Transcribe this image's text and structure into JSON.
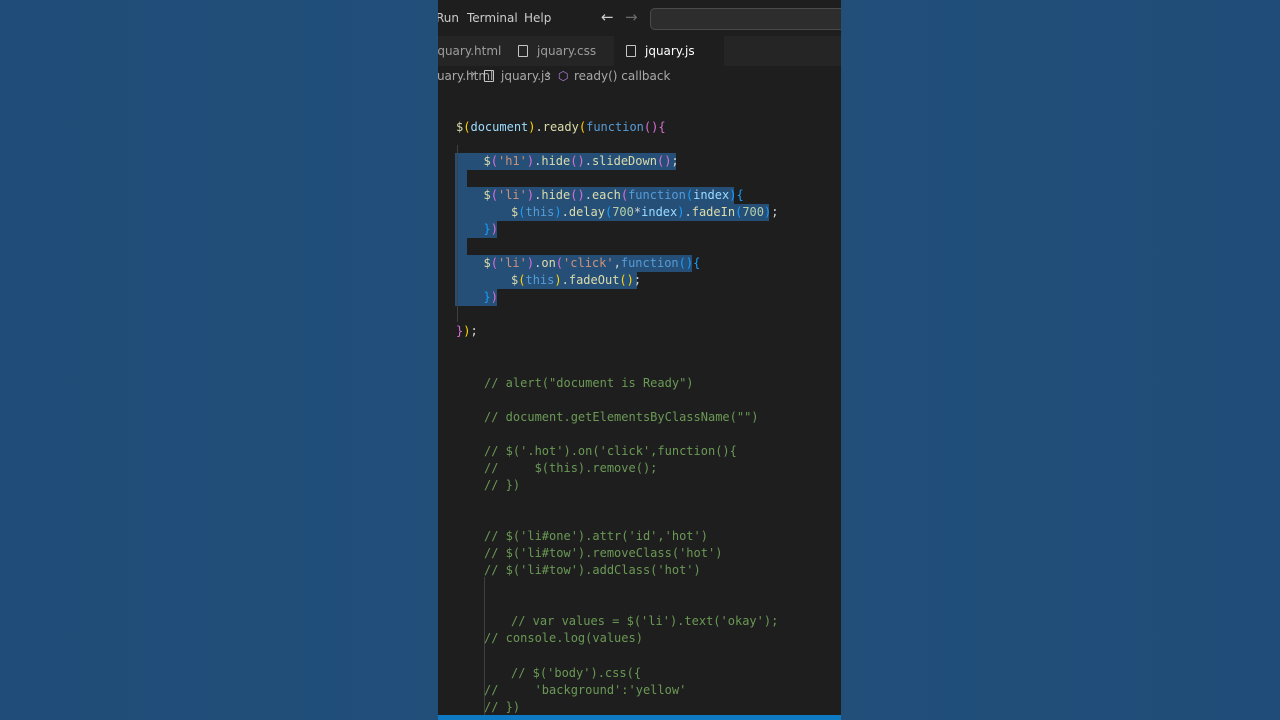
{
  "menu": {
    "items": [
      "Run",
      "Terminal",
      "Help"
    ]
  },
  "tabs": [
    {
      "label": "jquary.html",
      "active": false
    },
    {
      "label": "jquary.css",
      "active": false
    },
    {
      "label": "jquary.js",
      "active": true
    }
  ],
  "breadcrumb": {
    "file_html": "jquary.html",
    "file_js": "jquary.js",
    "symbol": "ready() callback"
  },
  "colors": {
    "accent": "#0e7ac4",
    "selection": "#264f78",
    "editor_bg": "#1e1e1e",
    "page_bg": "#22507a"
  },
  "code": {
    "line1": [
      [
        "$",
        "fn"
      ],
      [
        "(",
        "yel"
      ],
      [
        "document",
        "var"
      ],
      [
        ")",
        "yel"
      ],
      [
        ".",
        "plain"
      ],
      [
        "ready",
        "fn"
      ],
      [
        "(",
        "yel"
      ],
      [
        "function",
        "kw"
      ],
      [
        "(",
        "pur"
      ],
      [
        ")",
        "pur"
      ],
      [
        "{",
        "pur"
      ]
    ],
    "line2": [
      [
        "$",
        "fn"
      ],
      [
        "(",
        "pur"
      ],
      [
        "'h1'",
        "str"
      ],
      [
        ")",
        "pur"
      ],
      [
        ".",
        "plain"
      ],
      [
        "hide",
        "fn"
      ],
      [
        "()",
        "pur"
      ],
      [
        ".",
        "plain"
      ],
      [
        "slideDown",
        "fn"
      ],
      [
        "()",
        "pur"
      ],
      [
        ";",
        "plain"
      ]
    ],
    "line3": [
      [
        "$",
        "fn"
      ],
      [
        "(",
        "pur"
      ],
      [
        "'li'",
        "str"
      ],
      [
        ")",
        "pur"
      ],
      [
        ".",
        "plain"
      ],
      [
        "hide",
        "fn"
      ],
      [
        "()",
        "pur"
      ],
      [
        ".",
        "plain"
      ],
      [
        "each",
        "fn"
      ],
      [
        "(",
        "pur"
      ],
      [
        "function",
        "kw"
      ],
      [
        "(",
        "blu"
      ],
      [
        "index",
        "var"
      ],
      [
        ")",
        "blu"
      ],
      [
        "{",
        "blu"
      ]
    ],
    "line4": [
      [
        "$",
        "fn"
      ],
      [
        "(",
        "blu"
      ],
      [
        "this",
        "kw"
      ],
      [
        ")",
        "blu"
      ],
      [
        ".",
        "plain"
      ],
      [
        "delay",
        "fn"
      ],
      [
        "(",
        "blu"
      ],
      [
        "700",
        "num"
      ],
      [
        "*",
        "plain"
      ],
      [
        "index",
        "var"
      ],
      [
        ")",
        "blu"
      ],
      [
        ".",
        "plain"
      ],
      [
        "fadeIn",
        "fn"
      ],
      [
        "(",
        "blu"
      ],
      [
        "700",
        "num"
      ],
      [
        ")",
        "blu"
      ],
      [
        ";",
        "plain"
      ]
    ],
    "line5": [
      [
        "}",
        "blu"
      ],
      [
        ")",
        "pur"
      ]
    ],
    "line6": [
      [
        "$",
        "fn"
      ],
      [
        "(",
        "pur"
      ],
      [
        "'li'",
        "str"
      ],
      [
        ")",
        "pur"
      ],
      [
        ".",
        "plain"
      ],
      [
        "on",
        "fn"
      ],
      [
        "(",
        "pur"
      ],
      [
        "'click'",
        "str"
      ],
      [
        ",",
        "plain"
      ],
      [
        "function",
        "kw"
      ],
      [
        "(",
        "blu"
      ],
      [
        ")",
        "blu"
      ],
      [
        "{",
        "blu"
      ]
    ],
    "line7": [
      [
        "$",
        "fn"
      ],
      [
        "(",
        "yel"
      ],
      [
        "this",
        "kw"
      ],
      [
        ")",
        "yel"
      ],
      [
        ".",
        "plain"
      ],
      [
        "fadeOut",
        "fn"
      ],
      [
        "()",
        "yel"
      ],
      [
        ";",
        "plain"
      ]
    ],
    "line8": [
      [
        "}",
        "blu"
      ],
      [
        ")",
        "pur"
      ]
    ],
    "line9": [
      [
        "}",
        "pur"
      ],
      [
        ")",
        "yel"
      ],
      [
        ";",
        "plain"
      ]
    ],
    "comments": [
      "// alert(\"document is Ready\")",
      "// document.getElementsByClassName(\"\")",
      "// $('.hot').on('click',function(){",
      "//     $(this).remove();",
      "// })",
      "// $('li#one').attr('id','hot')",
      "// $('li#tow').removeClass('hot')",
      "// $('li#tow').addClass('hot')",
      "// var values = $('li').text('okay');",
      "// console.log(values)",
      "// $('body').css({",
      "//     'background':'yellow'",
      "// })"
    ]
  }
}
